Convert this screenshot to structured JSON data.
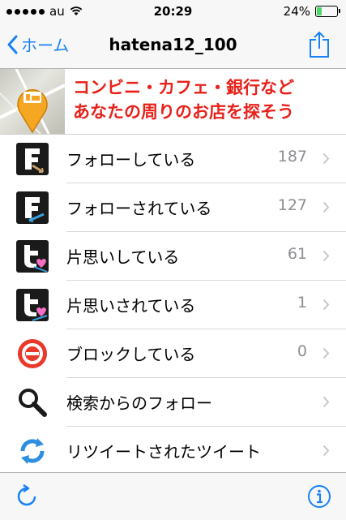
{
  "status_bar": {
    "carrier": "au",
    "time": "20:29",
    "battery_percent": "24%",
    "signal_bars": 5,
    "battery_level": 0.24
  },
  "nav": {
    "back_label": "ホーム",
    "title": "hatena12_100"
  },
  "banner": {
    "line1": "コンビニ・カフェ・銀行など",
    "line2": "あなたの周りのお店を探そう"
  },
  "rows": [
    {
      "label": "フォローしている",
      "count": "187",
      "icon": "follow-f-icon"
    },
    {
      "label": "フォローされている",
      "count": "127",
      "icon": "followed-f-icon"
    },
    {
      "label": "片思いしている",
      "count": "61",
      "icon": "one-way-following-icon"
    },
    {
      "label": "片思いされている",
      "count": "1",
      "icon": "one-way-followed-icon"
    },
    {
      "label": "ブロックしている",
      "count": "0",
      "icon": "block-icon"
    },
    {
      "label": "検索からのフォロー",
      "count": "",
      "icon": "search-icon"
    },
    {
      "label": "リツイートされたツイート",
      "count": "",
      "icon": "retweet-icon"
    }
  ],
  "colors": {
    "accent": "#1a82f7",
    "banner_text": "#e8211a",
    "count_text": "#8e8e93",
    "block_red": "#e8392a"
  }
}
